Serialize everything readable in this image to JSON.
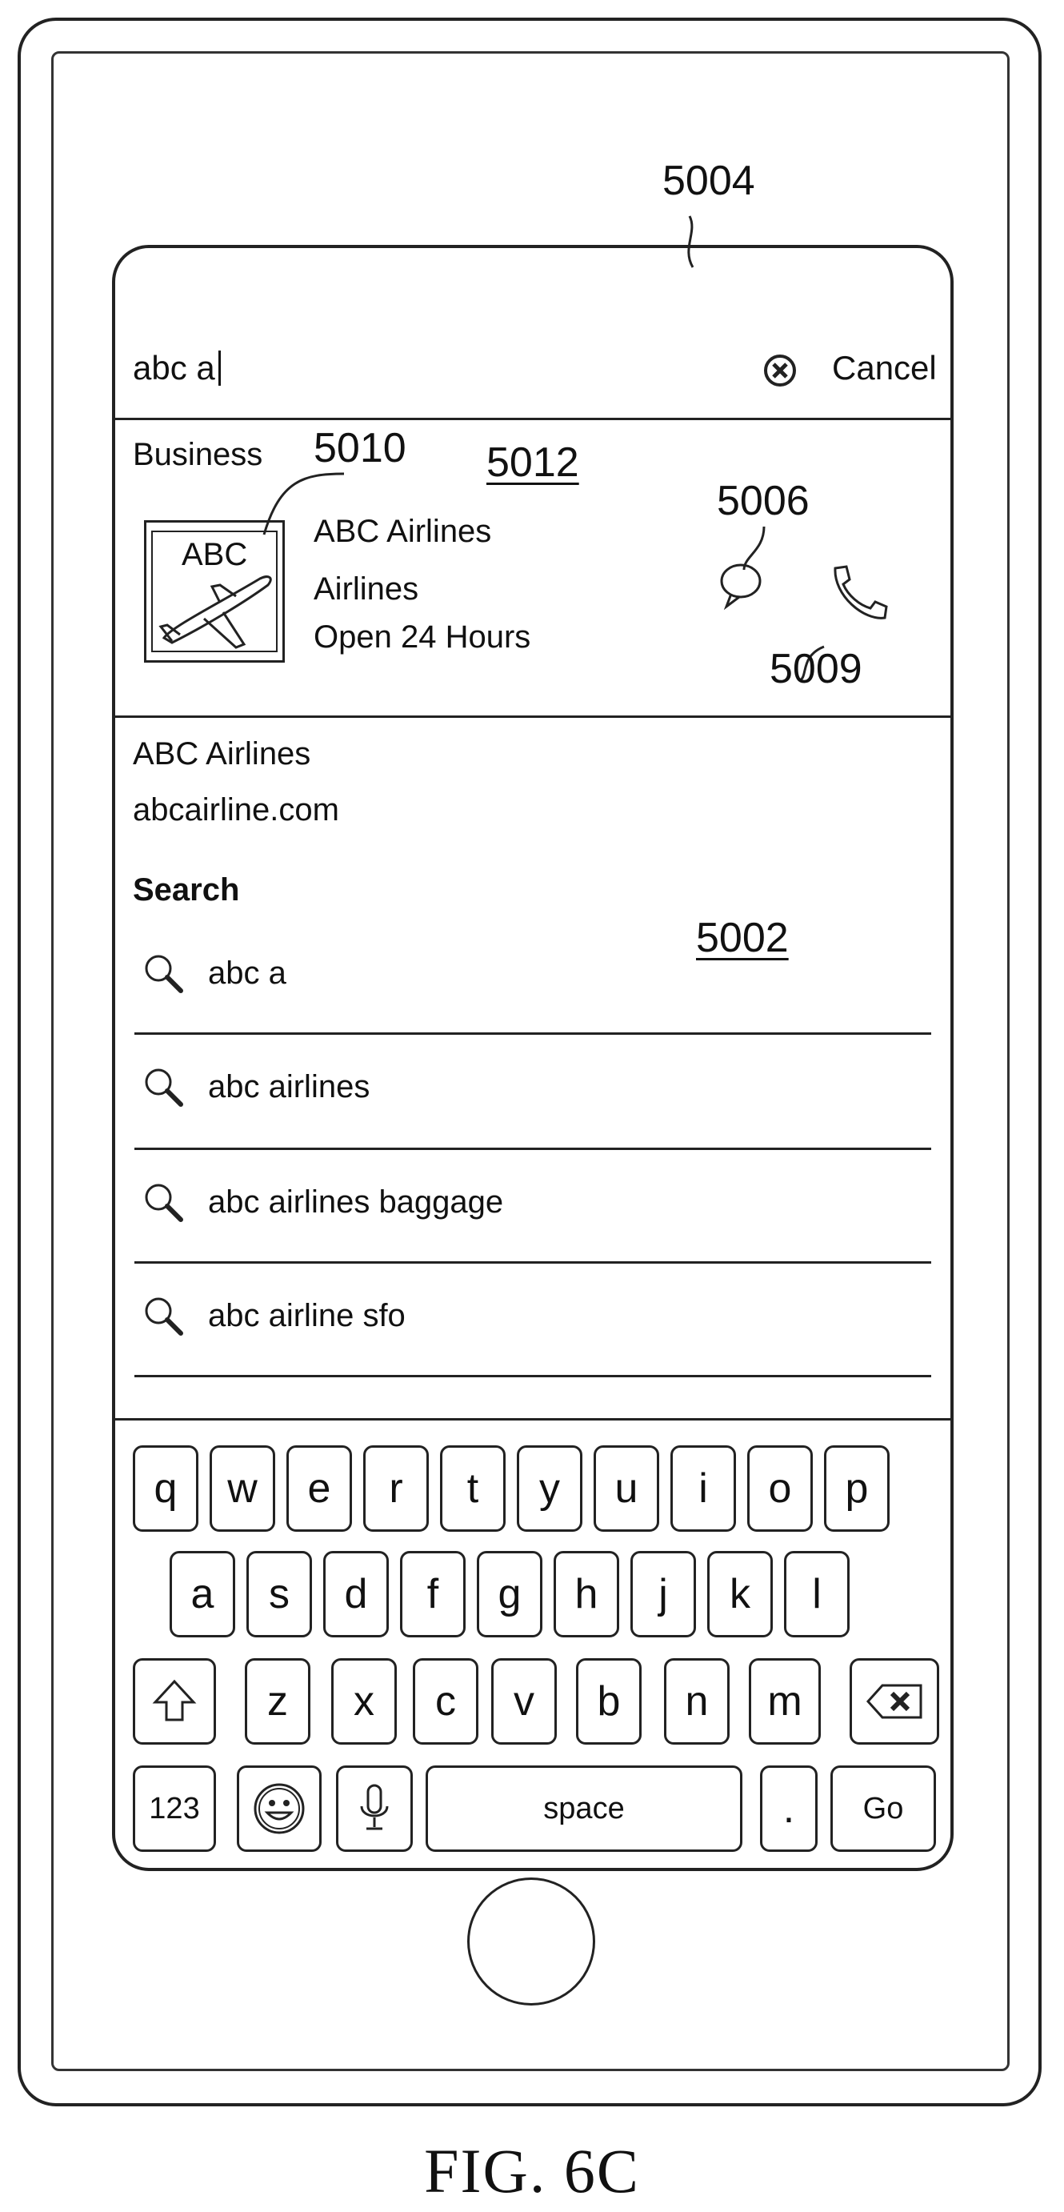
{
  "labels": {
    "device": "5004",
    "suggestions_area": "5002",
    "card": "5012",
    "logo": "5010",
    "message_icon": "5006",
    "phone_icon": "5009"
  },
  "search_bar": {
    "query": "abc a",
    "cancel_label": "Cancel"
  },
  "business_card": {
    "section_label": "Business",
    "logo_text": "ABC",
    "name": "ABC Airlines",
    "category": "Airlines",
    "hours": "Open 24 Hours"
  },
  "site_result": {
    "title": "ABC Airlines",
    "url": "abcairline.com"
  },
  "search_section": {
    "heading": "Search",
    "suggestions": [
      "abc a",
      "abc airlines",
      "abc airlines baggage",
      "abc airline sfo"
    ]
  },
  "keyboard": {
    "row1": [
      "q",
      "w",
      "e",
      "r",
      "t",
      "y",
      "u",
      "i",
      "o",
      "p"
    ],
    "row2": [
      "a",
      "s",
      "d",
      "f",
      "g",
      "h",
      "j",
      "k",
      "l"
    ],
    "row3": [
      "z",
      "x",
      "c",
      "v",
      "b",
      "n",
      "m"
    ],
    "numbers_label": "123",
    "space_label": "space",
    "period_label": ".",
    "go_label": "Go"
  },
  "icons": [
    "clear-icon",
    "airplane-icon",
    "message-bubble-icon",
    "phone-icon",
    "search-icon",
    "shift-icon",
    "backspace-icon",
    "emoji-icon",
    "microphone-icon"
  ],
  "figure_caption": "FIG. 6C"
}
